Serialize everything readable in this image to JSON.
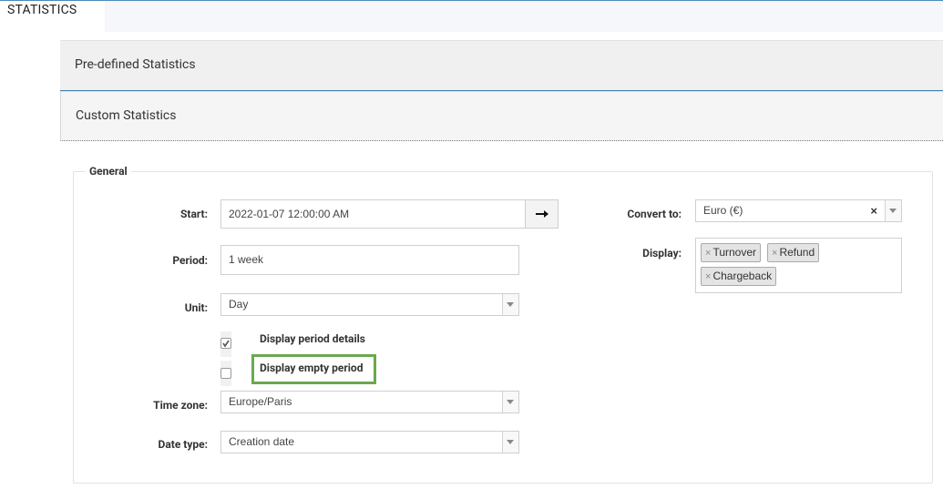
{
  "tabs": {
    "active": "STATISTICS"
  },
  "accordion": {
    "predefined": "Pre-defined Statistics",
    "custom": "Custom Statistics"
  },
  "general": {
    "legend": "General",
    "start": {
      "label": "Start:",
      "value": "2022-01-07 12:00:00 AM"
    },
    "period": {
      "label": "Period:",
      "value": "1 week"
    },
    "unit": {
      "label": "Unit:",
      "value": "Day"
    },
    "display_period_details": {
      "label": "Display period details",
      "checked": true
    },
    "display_empty_period": {
      "label": "Display empty period",
      "checked": false
    },
    "time_zone": {
      "label": "Time zone:",
      "value": "Europe/Paris"
    },
    "date_type": {
      "label": "Date type:",
      "value": "Creation date"
    },
    "convert_to": {
      "label": "Convert to:",
      "value": "Euro (€)",
      "clear": "×"
    },
    "display": {
      "label": "Display:",
      "chips": [
        "Turnover",
        "Refund",
        "Chargeback"
      ],
      "remove_glyph": "×"
    }
  },
  "colors": {
    "highlight": "#6aa84f",
    "accent": "#4e8ab8"
  },
  "icons": {
    "start_button": "arrow-right-icon",
    "dropdown": "caret-down-icon"
  }
}
